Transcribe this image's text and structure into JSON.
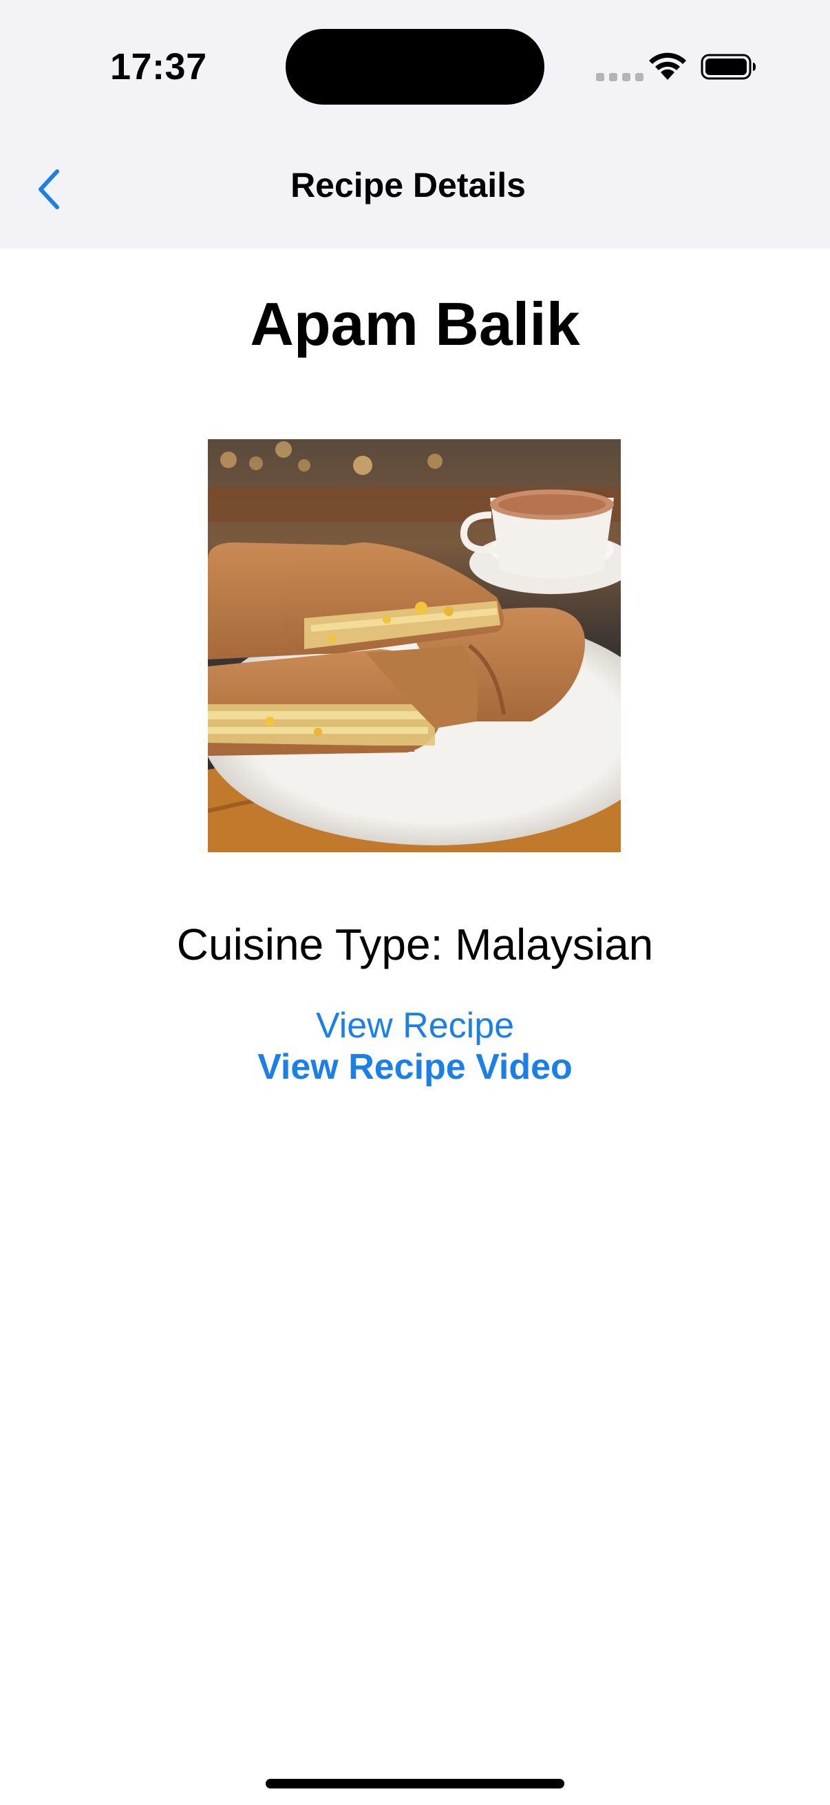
{
  "status_bar": {
    "time": "17:37"
  },
  "nav": {
    "title": "Recipe Details",
    "back_icon": "chevron-left-icon"
  },
  "recipe": {
    "name": "Apam Balik",
    "photo_subject": "apam-balik-pancake-photo",
    "cuisine_label": "Cuisine Type: Malaysian",
    "view_recipe_label": "View Recipe",
    "view_video_label": "View Recipe Video"
  },
  "colors": {
    "accent": "#1a7fe6",
    "nav_background": "#f2f2f7",
    "content_background": "#ffffff"
  }
}
